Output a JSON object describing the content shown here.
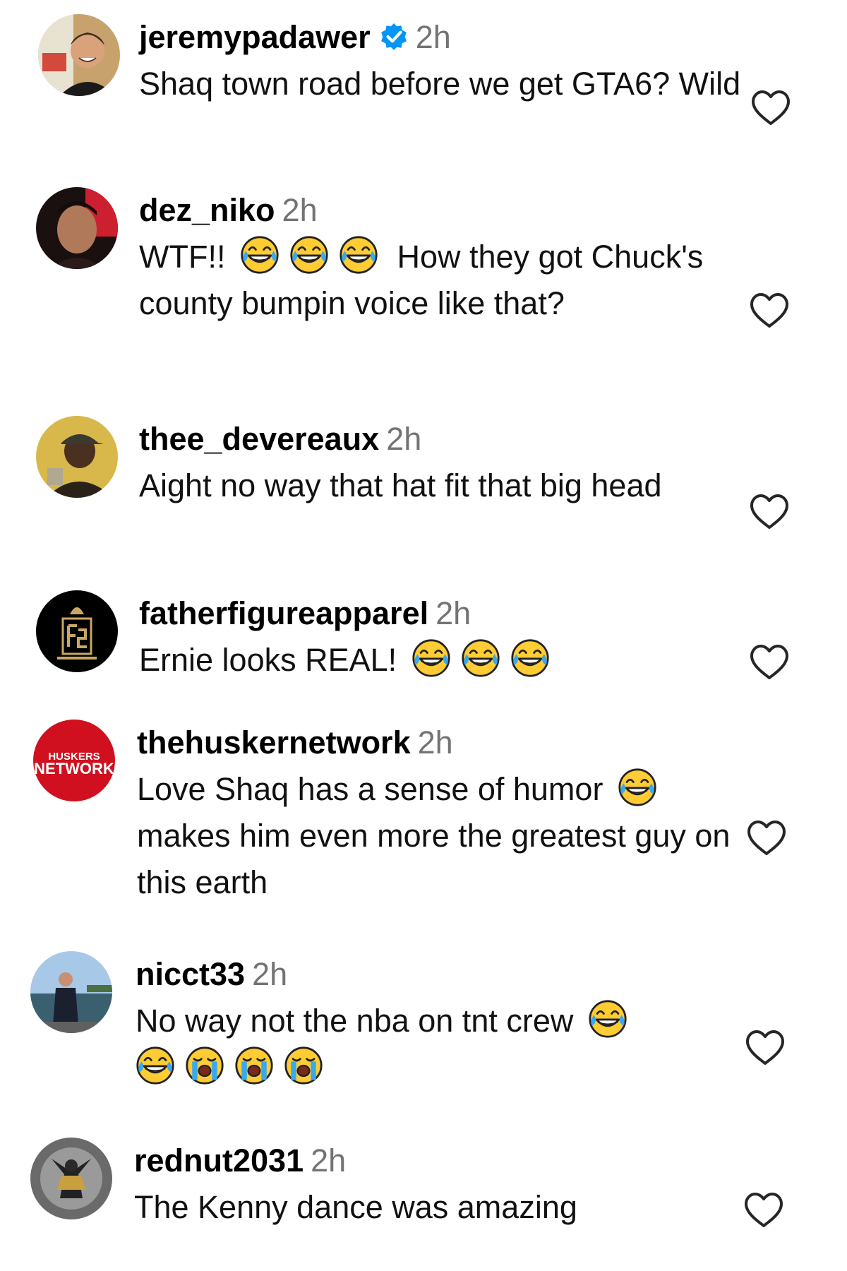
{
  "colors": {
    "secondary_text": "#737373",
    "verified_badge": "#0095f6",
    "heart_outline": "#262626"
  },
  "comments": [
    {
      "username": "jeremypadawer",
      "verified": true,
      "time": "2h",
      "text": "Shaq town road before we get GTA6? Wild",
      "avatar": "man-smiling-photo",
      "emojis": []
    },
    {
      "username": "dez_niko",
      "verified": false,
      "time": "2h",
      "text_before": "WTF!!",
      "text": "How they got Chuck's county bumpin voice like that?",
      "emojis": [
        "face-with-tears-of-joy",
        "face-with-tears-of-joy",
        "face-with-tears-of-joy"
      ]
    },
    {
      "username": "thee_devereaux",
      "verified": false,
      "time": "2h",
      "text": "Aight no way that hat fit that big head",
      "emojis": []
    },
    {
      "username": "fatherfigureapparel",
      "verified": false,
      "time": "2h",
      "text": "Ernie looks REAL!",
      "emojis": [
        "face-with-tears-of-joy",
        "face-with-tears-of-joy",
        "face-with-tears-of-joy"
      ]
    },
    {
      "username": "thehuskernetwork",
      "verified": false,
      "time": "2h",
      "text": "Love Shaq has a sense of humor",
      "text_after": "makes him even more the greatest guy on this earth",
      "emojis": [
        "face-with-tears-of-joy"
      ],
      "avatar_text_1": "HUSKERS",
      "avatar_text_2": "NETWORK"
    },
    {
      "username": "nicct33",
      "verified": false,
      "time": "2h",
      "text": "No way not the nba on tnt crew",
      "emojis": [
        "face-with-tears-of-joy",
        "face-with-tears-of-joy",
        "loudly-crying-face",
        "loudly-crying-face",
        "loudly-crying-face"
      ]
    },
    {
      "username": "rednut2031",
      "verified": false,
      "time": "2h",
      "text": "The Kenny dance was amazing",
      "emojis": []
    }
  ]
}
